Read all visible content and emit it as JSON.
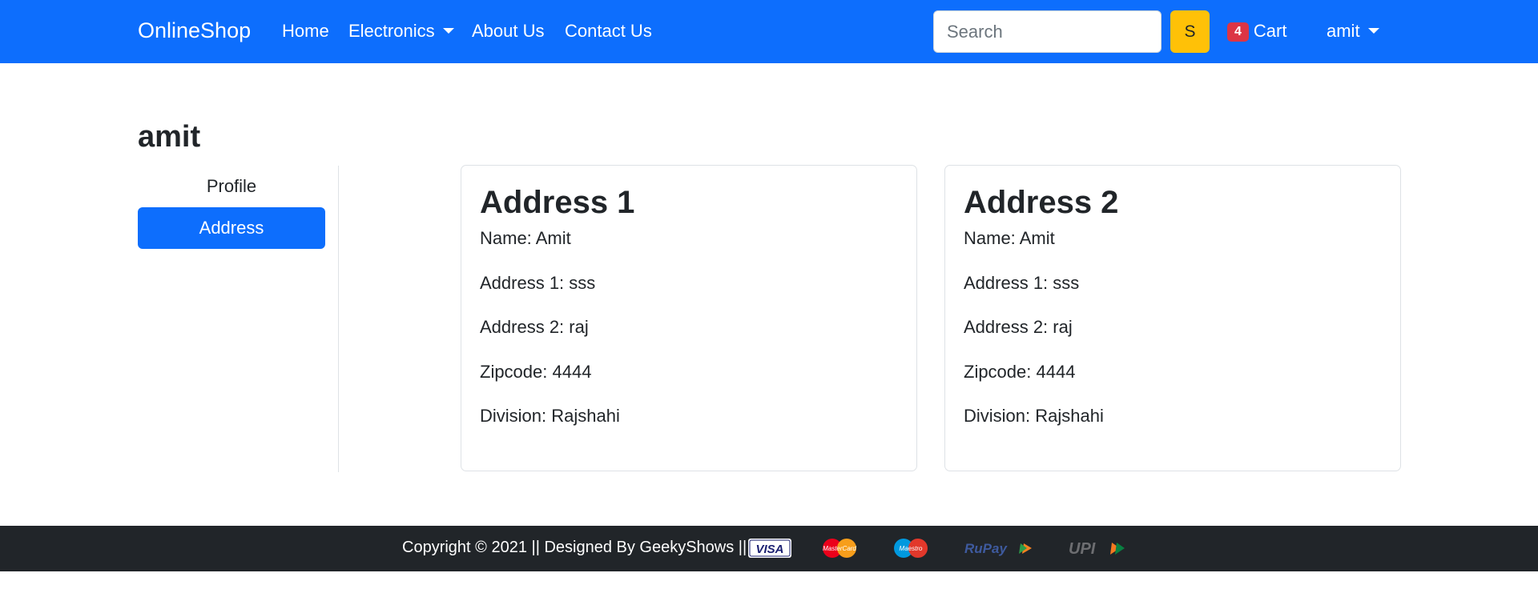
{
  "navbar": {
    "brand": "OnlineShop",
    "links": [
      {
        "label": "Home"
      },
      {
        "label": "Electronics"
      },
      {
        "label": "About Us"
      },
      {
        "label": "Contact Us"
      }
    ],
    "search": {
      "placeholder": "Search",
      "value": "",
      "button_label": "S"
    },
    "cart": {
      "count": "4",
      "label": "Cart"
    },
    "user": {
      "label": "amit"
    }
  },
  "page": {
    "title": "amit"
  },
  "sidebar": {
    "items": [
      {
        "label": "Profile",
        "active": false
      },
      {
        "label": "Address",
        "active": true
      }
    ]
  },
  "addresses": [
    {
      "title": "Address 1",
      "lines": [
        "Name: Amit",
        "Address 1: sss",
        "Address 2: raj",
        "Zipcode: 4444",
        "Division: Rajshahi"
      ]
    },
    {
      "title": "Address 2",
      "lines": [
        "Name: Amit",
        "Address 1: sss",
        "Address 2: raj",
        "Zipcode: 4444",
        "Division: Rajshahi"
      ]
    }
  ],
  "footer": {
    "text": "Copyright © 2021 || Designed By GeekyShows ||",
    "payment_logos": [
      {
        "icon": "visa-logo",
        "label": "VISA"
      },
      {
        "icon": "mastercard-logo",
        "label": "MasterCard"
      },
      {
        "icon": "maestro-logo",
        "label": "Maestro"
      },
      {
        "icon": "rupay-logo",
        "label": "RuPay"
      },
      {
        "icon": "upi-logo",
        "label": "UPI"
      }
    ]
  },
  "colors": {
    "primary": "#0d6efd",
    "warning": "#ffc107",
    "danger": "#dc3545",
    "dark": "#212529"
  }
}
